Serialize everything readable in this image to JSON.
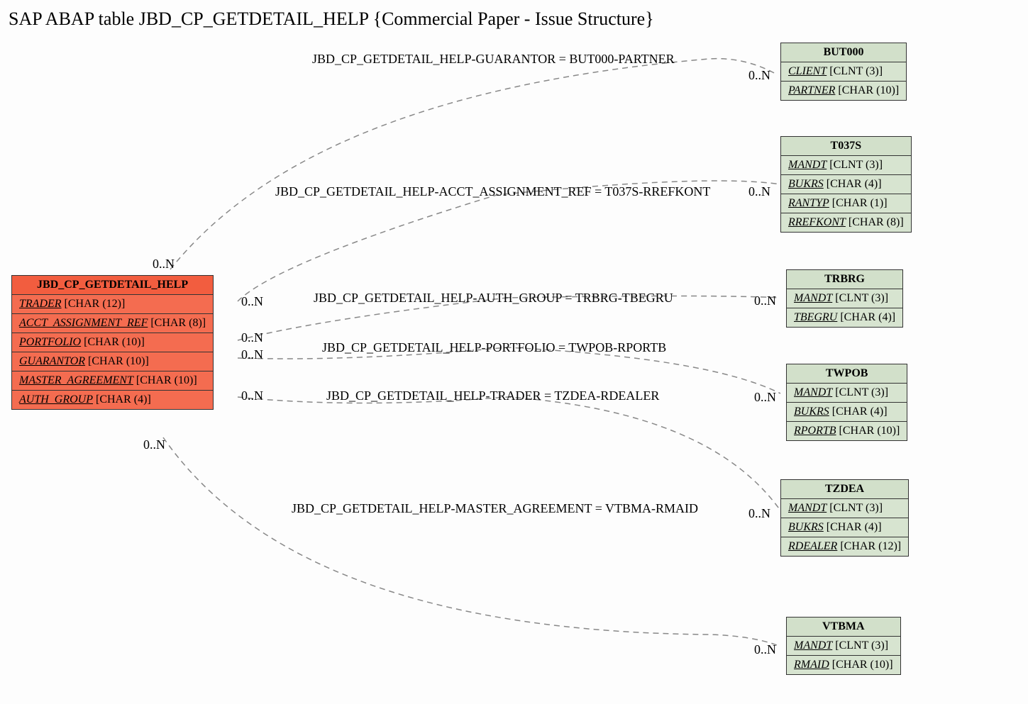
{
  "title": "SAP ABAP table JBD_CP_GETDETAIL_HELP {Commercial Paper - Issue Structure}",
  "main_entity": {
    "name": "JBD_CP_GETDETAIL_HELP",
    "fields": [
      {
        "name": "TRADER",
        "type": "[CHAR (12)]"
      },
      {
        "name": "ACCT_ASSIGNMENT_REF",
        "type": "[CHAR (8)]"
      },
      {
        "name": "PORTFOLIO",
        "type": "[CHAR (10)]"
      },
      {
        "name": "GUARANTOR",
        "type": "[CHAR (10)]"
      },
      {
        "name": "MASTER_AGREEMENT",
        "type": "[CHAR (10)]"
      },
      {
        "name": "AUTH_GROUP",
        "type": "[CHAR (4)]"
      }
    ]
  },
  "related": [
    {
      "name": "BUT000",
      "fields": [
        {
          "name": "CLIENT",
          "type": "[CLNT (3)]"
        },
        {
          "name": "PARTNER",
          "type": "[CHAR (10)]"
        }
      ]
    },
    {
      "name": "T037S",
      "fields": [
        {
          "name": "MANDT",
          "type": "[CLNT (3)]"
        },
        {
          "name": "BUKRS",
          "type": "[CHAR (4)]"
        },
        {
          "name": "RANTYP",
          "type": "[CHAR (1)]"
        },
        {
          "name": "RREFKONT",
          "type": "[CHAR (8)]"
        }
      ]
    },
    {
      "name": "TRBRG",
      "fields": [
        {
          "name": "MANDT",
          "type": "[CLNT (3)]"
        },
        {
          "name": "TBEGRU",
          "type": "[CHAR (4)]"
        }
      ]
    },
    {
      "name": "TWPOB",
      "fields": [
        {
          "name": "MANDT",
          "type": "[CLNT (3)]"
        },
        {
          "name": "BUKRS",
          "type": "[CHAR (4)]"
        },
        {
          "name": "RPORTB",
          "type": "[CHAR (10)]"
        }
      ]
    },
    {
      "name": "TZDEA",
      "fields": [
        {
          "name": "MANDT",
          "type": "[CLNT (3)]"
        },
        {
          "name": "BUKRS",
          "type": "[CHAR (4)]"
        },
        {
          "name": "RDEALER",
          "type": "[CHAR (12)]"
        }
      ]
    },
    {
      "name": "VTBMA",
      "fields": [
        {
          "name": "MANDT",
          "type": "[CLNT (3)]"
        },
        {
          "name": "RMAID",
          "type": "[CHAR (10)]"
        }
      ]
    }
  ],
  "relations": [
    {
      "text": "JBD_CP_GETDETAIL_HELP-GUARANTOR = BUT000-PARTNER"
    },
    {
      "text": "JBD_CP_GETDETAIL_HELP-ACCT_ASSIGNMENT_REF = T037S-RREFKONT"
    },
    {
      "text": "JBD_CP_GETDETAIL_HELP-AUTH_GROUP = TRBRG-TBEGRU"
    },
    {
      "text": "JBD_CP_GETDETAIL_HELP-PORTFOLIO = TWPOB-RPORTB"
    },
    {
      "text": "JBD_CP_GETDETAIL_HELP-TRADER = TZDEA-RDEALER"
    },
    {
      "text": "JBD_CP_GETDETAIL_HELP-MASTER_AGREEMENT = VTBMA-RMAID"
    }
  ],
  "card": {
    "m1": "0..N",
    "m2": "0..N",
    "m3": "0..N",
    "m4": "0..N",
    "m5": "0..N",
    "m6": "0..N",
    "r1": "0..N",
    "r2": "0..N",
    "r3": "0..N",
    "r4": "0..N",
    "r5": "0..N",
    "r6": "0..N"
  }
}
